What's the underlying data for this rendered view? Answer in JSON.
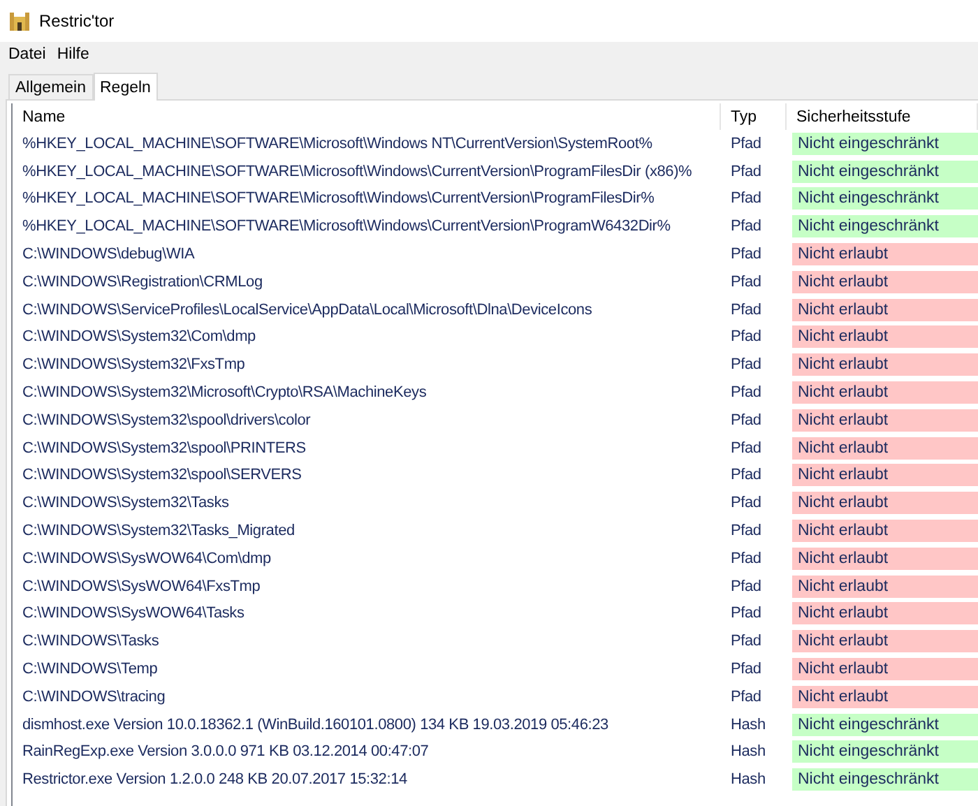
{
  "window": {
    "title": "Restric'tor"
  },
  "menu": [
    "Datei",
    "Hilfe"
  ],
  "tabs": [
    {
      "label": "Allgemein",
      "selected": false
    },
    {
      "label": "Regeln",
      "selected": true
    }
  ],
  "table": {
    "columns": [
      "Name",
      "Typ",
      "Sicherheitsstufe"
    ],
    "rows": [
      {
        "name": "%HKEY_LOCAL_MACHINE\\SOFTWARE\\Microsoft\\Windows NT\\CurrentVersion\\SystemRoot%",
        "type": "Pfad",
        "level_text": "Nicht eingeschränkt",
        "kind": "unrestricted"
      },
      {
        "name": "%HKEY_LOCAL_MACHINE\\SOFTWARE\\Microsoft\\Windows\\CurrentVersion\\ProgramFilesDir (x86)%",
        "type": "Pfad",
        "level_text": "Nicht eingeschränkt",
        "kind": "unrestricted"
      },
      {
        "name": "%HKEY_LOCAL_MACHINE\\SOFTWARE\\Microsoft\\Windows\\CurrentVersion\\ProgramFilesDir%",
        "type": "Pfad",
        "level_text": "Nicht eingeschränkt",
        "kind": "unrestricted"
      },
      {
        "name": "%HKEY_LOCAL_MACHINE\\SOFTWARE\\Microsoft\\Windows\\CurrentVersion\\ProgramW6432Dir%",
        "type": "Pfad",
        "level_text": "Nicht eingeschränkt",
        "kind": "unrestricted"
      },
      {
        "name": "C:\\WINDOWS\\debug\\WIA",
        "type": "Pfad",
        "level_text": "Nicht erlaubt",
        "kind": "disallowed"
      },
      {
        "name": "C:\\WINDOWS\\Registration\\CRMLog",
        "type": "Pfad",
        "level_text": "Nicht erlaubt",
        "kind": "disallowed"
      },
      {
        "name": "C:\\WINDOWS\\ServiceProfiles\\LocalService\\AppData\\Local\\Microsoft\\Dlna\\DeviceIcons",
        "type": "Pfad",
        "level_text": "Nicht erlaubt",
        "kind": "disallowed"
      },
      {
        "name": "C:\\WINDOWS\\System32\\Com\\dmp",
        "type": "Pfad",
        "level_text": "Nicht erlaubt",
        "kind": "disallowed"
      },
      {
        "name": "C:\\WINDOWS\\System32\\FxsTmp",
        "type": "Pfad",
        "level_text": "Nicht erlaubt",
        "kind": "disallowed"
      },
      {
        "name": "C:\\WINDOWS\\System32\\Microsoft\\Crypto\\RSA\\MachineKeys",
        "type": "Pfad",
        "level_text": "Nicht erlaubt",
        "kind": "disallowed"
      },
      {
        "name": "C:\\WINDOWS\\System32\\spool\\drivers\\color",
        "type": "Pfad",
        "level_text": "Nicht erlaubt",
        "kind": "disallowed"
      },
      {
        "name": "C:\\WINDOWS\\System32\\spool\\PRINTERS",
        "type": "Pfad",
        "level_text": "Nicht erlaubt",
        "kind": "disallowed"
      },
      {
        "name": "C:\\WINDOWS\\System32\\spool\\SERVERS",
        "type": "Pfad",
        "level_text": "Nicht erlaubt",
        "kind": "disallowed"
      },
      {
        "name": "C:\\WINDOWS\\System32\\Tasks",
        "type": "Pfad",
        "level_text": "Nicht erlaubt",
        "kind": "disallowed"
      },
      {
        "name": "C:\\WINDOWS\\System32\\Tasks_Migrated",
        "type": "Pfad",
        "level_text": "Nicht erlaubt",
        "kind": "disallowed"
      },
      {
        "name": "C:\\WINDOWS\\SysWOW64\\Com\\dmp",
        "type": "Pfad",
        "level_text": "Nicht erlaubt",
        "kind": "disallowed"
      },
      {
        "name": "C:\\WINDOWS\\SysWOW64\\FxsTmp",
        "type": "Pfad",
        "level_text": "Nicht erlaubt",
        "kind": "disallowed"
      },
      {
        "name": "C:\\WINDOWS\\SysWOW64\\Tasks",
        "type": "Pfad",
        "level_text": "Nicht erlaubt",
        "kind": "disallowed"
      },
      {
        "name": "C:\\WINDOWS\\Tasks",
        "type": "Pfad",
        "level_text": "Nicht erlaubt",
        "kind": "disallowed"
      },
      {
        "name": "C:\\WINDOWS\\Temp",
        "type": "Pfad",
        "level_text": "Nicht erlaubt",
        "kind": "disallowed"
      },
      {
        "name": "C:\\WINDOWS\\tracing",
        "type": "Pfad",
        "level_text": "Nicht erlaubt",
        "kind": "disallowed"
      },
      {
        "name": "dismhost.exe Version 10.0.18362.1 (WinBuild.160101.0800) 134 KB 19.03.2019  05:46:23",
        "type": "Hash",
        "level_text": "Nicht eingeschränkt",
        "kind": "unrestricted"
      },
      {
        "name": "RainRegExp.exe Version 3.0.0.0 971 KB 03.12.2014  00:47:07",
        "type": "Hash",
        "level_text": "Nicht eingeschränkt",
        "kind": "unrestricted"
      },
      {
        "name": "Restrictor.exe Version 1.2.0.0 248 KB 20.07.2017  15:32:14",
        "type": "Hash",
        "level_text": "Nicht eingeschränkt",
        "kind": "unrestricted"
      }
    ]
  }
}
